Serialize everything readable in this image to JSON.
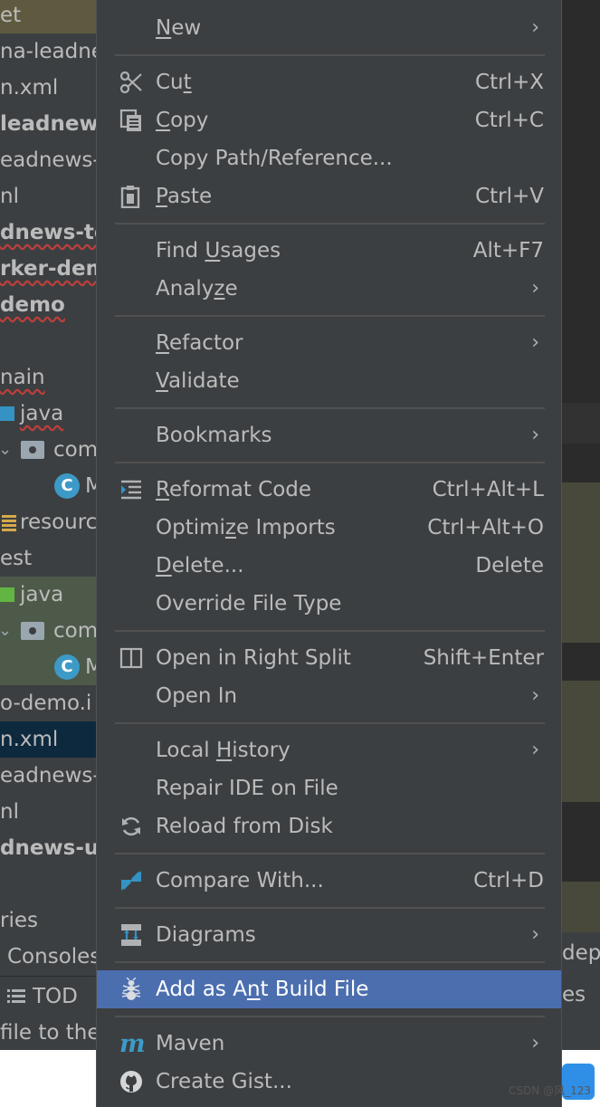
{
  "tree": {
    "rows": [
      "et",
      "na-leadne",
      "n.xml",
      "leadnews",
      "eadnews-",
      "nl",
      "dnews-te",
      "rker-dem",
      "demo",
      "",
      "nain",
      "java",
      "com",
      "M",
      "resourc",
      "est",
      "java",
      "com",
      "M",
      "o-demo.i",
      "n.xml",
      "eadnews-",
      "nl",
      "dnews-ut",
      "",
      "ries",
      "Consoles"
    ],
    "todo_label": "TOD",
    "status_text": "file to the"
  },
  "right": {
    "consoles_text": "dep",
    "todo_text": "es"
  },
  "menu": {
    "items": [
      {
        "pre": "",
        "ul": "N",
        "post": "ew",
        "shortcut": "",
        "submenu": true,
        "icon": ""
      },
      {
        "pre": "Cu",
        "ul": "t",
        "post": "",
        "shortcut": "Ctrl+X",
        "submenu": false,
        "icon": "scissors-icon"
      },
      {
        "pre": "",
        "ul": "C",
        "post": "opy",
        "shortcut": "Ctrl+C",
        "submenu": false,
        "icon": "copy-icon"
      },
      {
        "pre": "Copy Path/Reference...",
        "ul": "",
        "post": "",
        "shortcut": "",
        "submenu": false,
        "icon": ""
      },
      {
        "pre": "",
        "ul": "P",
        "post": "aste",
        "shortcut": "Ctrl+V",
        "submenu": false,
        "icon": "clipboard-icon"
      },
      {
        "pre": "Find ",
        "ul": "U",
        "post": "sages",
        "shortcut": "Alt+F7",
        "submenu": false,
        "icon": ""
      },
      {
        "pre": "Analy",
        "ul": "z",
        "post": "e",
        "shortcut": "",
        "submenu": true,
        "icon": ""
      },
      {
        "pre": "",
        "ul": "R",
        "post": "efactor",
        "shortcut": "",
        "submenu": true,
        "icon": ""
      },
      {
        "pre": "",
        "ul": "V",
        "post": "alidate",
        "shortcut": "",
        "submenu": false,
        "icon": ""
      },
      {
        "pre": "Bookmarks",
        "ul": "",
        "post": "",
        "shortcut": "",
        "submenu": true,
        "icon": ""
      },
      {
        "pre": "",
        "ul": "R",
        "post": "eformat Code",
        "shortcut": "Ctrl+Alt+L",
        "submenu": false,
        "icon": "reformat-icon"
      },
      {
        "pre": "Optimi",
        "ul": "z",
        "post": "e Imports",
        "shortcut": "Ctrl+Alt+O",
        "submenu": false,
        "icon": ""
      },
      {
        "pre": "",
        "ul": "D",
        "post": "elete...",
        "shortcut": "Delete",
        "submenu": false,
        "icon": ""
      },
      {
        "pre": "Override File Type",
        "ul": "",
        "post": "",
        "shortcut": "",
        "submenu": false,
        "icon": ""
      },
      {
        "pre": "Open in Right Split",
        "ul": "",
        "post": "",
        "shortcut": "Shift+Enter",
        "submenu": false,
        "icon": "split-icon"
      },
      {
        "pre": "Open In",
        "ul": "",
        "post": "",
        "shortcut": "",
        "submenu": true,
        "icon": ""
      },
      {
        "pre": "Local ",
        "ul": "H",
        "post": "istory",
        "shortcut": "",
        "submenu": true,
        "icon": ""
      },
      {
        "pre": "Repair IDE on File",
        "ul": "",
        "post": "",
        "shortcut": "",
        "submenu": false,
        "icon": ""
      },
      {
        "pre": "Reload from Disk",
        "ul": "",
        "post": "",
        "shortcut": "",
        "submenu": false,
        "icon": "reload-icon"
      },
      {
        "pre": "Compare With...",
        "ul": "",
        "post": "",
        "shortcut": "Ctrl+D",
        "submenu": false,
        "icon": "compare-icon"
      },
      {
        "pre": "Diagrams",
        "ul": "",
        "post": "",
        "shortcut": "",
        "submenu": true,
        "icon": "diagram-icon"
      },
      {
        "pre": "Add as A",
        "ul": "n",
        "post": "t Build File",
        "shortcut": "",
        "submenu": false,
        "icon": "ant-icon"
      },
      {
        "pre": "Maven",
        "ul": "",
        "post": "",
        "shortcut": "",
        "submenu": true,
        "icon": "maven-icon"
      },
      {
        "pre": "Create Gist...",
        "ul": "",
        "post": "",
        "shortcut": "",
        "submenu": false,
        "icon": "github-icon"
      }
    ],
    "submenu_glyph": "›"
  },
  "watermark": "CSDN @风_123"
}
